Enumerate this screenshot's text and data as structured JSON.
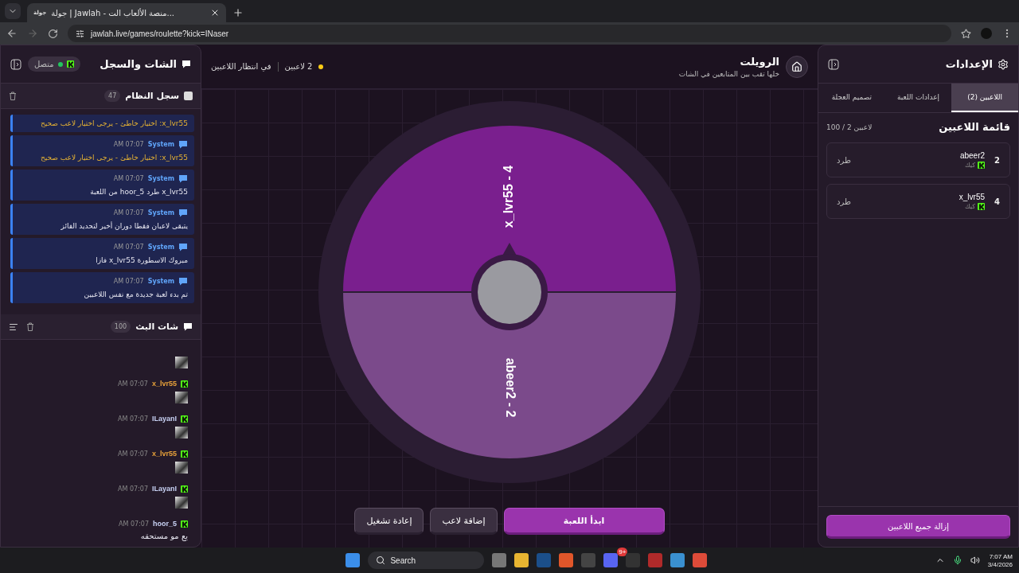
{
  "browser": {
    "tab_favicon_text": "جولة",
    "tab_title": "جولة | Jawlah - منصة الألعاب الت...",
    "url": "jawlah.live/games/roulette?kick=INaser"
  },
  "chat_panel": {
    "title": "الشات والسجل",
    "connection": {
      "label": "متصل",
      "online": true
    },
    "system_log": {
      "title": "سجل النظام",
      "count": "47",
      "messages": [
        {
          "text": "x_lvr55: اختيار خاطئ - يرجى اختيار لاعب صحيح",
          "warning": true
        },
        {
          "sender": "System",
          "time": "AM 07:07",
          "text": "x_lvr55: اختيار خاطئ - يرجى اختيار لاعب صحيح",
          "warning": true
        },
        {
          "sender": "System",
          "time": "AM 07:07",
          "text": "x_lvr55 طرد hoor_5 من اللعبة",
          "warning": false
        },
        {
          "sender": "System",
          "time": "AM 07:07",
          "text": "يتبقى لاعبان فقطا دوران أخير لتحديد الفائز",
          "warning": false
        },
        {
          "sender": "System",
          "time": "AM 07:07",
          "text": "مبروك الاسطورة x_lvr55 فازا",
          "warning": false
        },
        {
          "sender": "System",
          "time": "AM 07:07",
          "text": "تم بدء لعبة جديدة مع نفس اللاعبين",
          "warning": false
        }
      ]
    },
    "stream_chat": {
      "title": "شات البث",
      "count": "100",
      "messages": [
        {
          "kind": "emote"
        },
        {
          "kind": "emote",
          "user": "x_lvr55",
          "color": "#e8a23a",
          "time": "AM 07:07"
        },
        {
          "kind": "emote",
          "user": "ILayanI",
          "color": "#c9d3f5",
          "time": "AM 07:07"
        },
        {
          "kind": "emote",
          "user": "x_lvr55",
          "color": "#e8a23a",
          "time": "AM 07:07"
        },
        {
          "kind": "emote",
          "user": "ILayanI",
          "color": "#c9d3f5",
          "time": "AM 07:07"
        },
        {
          "kind": "text",
          "user": "hoor_5",
          "color": "#c9d3f5",
          "time": "AM 07:07",
          "text": "يع مو مستحقه"
        }
      ]
    }
  },
  "game": {
    "title": "الرويلت",
    "subtitle": "خلها تقب بين المتابعين في الشات",
    "player_count": "2 لاعبين",
    "status": "في انتظار اللاعبين",
    "wheel": {
      "segments": [
        {
          "label": "x_lvr55 - 4",
          "color": "#7a1f8e"
        },
        {
          "label": "abeer2 - 2",
          "color": "#7b4a8b"
        }
      ]
    },
    "buttons": [
      {
        "label": "ابدأ اللعبة",
        "kind": "primary"
      },
      {
        "label": "إضافة لاعب",
        "kind": "secondary"
      },
      {
        "label": "إعادة تشغيل",
        "kind": "secondary"
      }
    ]
  },
  "settings_panel": {
    "title": "الإعدادات",
    "tabs": [
      {
        "label": "اللاعبين (2)",
        "selected": true
      },
      {
        "label": "إعدادات اللعبة",
        "selected": false
      },
      {
        "label": "تصميم العجلة",
        "selected": false
      }
    ],
    "list_title": "قائمة اللاعبين",
    "list_count": "100 / 2 لاعبين",
    "players": [
      {
        "number": "2",
        "name": "abeer2",
        "platform": "كيك",
        "action": "طرد"
      },
      {
        "number": "4",
        "name": "x_lvr55",
        "platform": "كيك",
        "action": "طرد"
      }
    ],
    "remove_all": "إزالة جميع اللاعبين"
  },
  "taskbar": {
    "search": "Search",
    "discord_badge": "9+",
    "time": "7:07 AM",
    "date": "3/4/2026"
  }
}
